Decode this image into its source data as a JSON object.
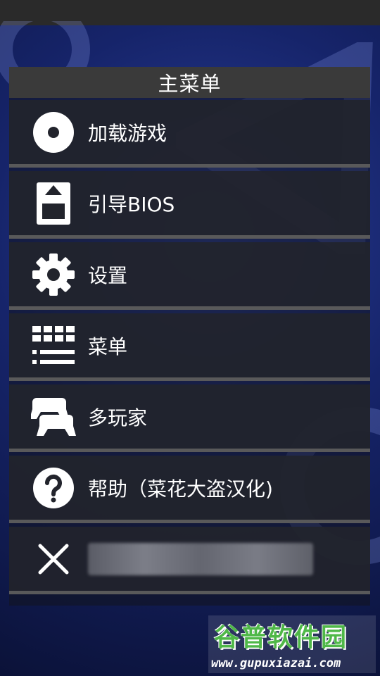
{
  "menu": {
    "title": "主菜单",
    "items": [
      {
        "label": "加载游戏",
        "icon": "disc-icon"
      },
      {
        "label": "引导BIOS",
        "icon": "memory-card-icon"
      },
      {
        "label": "设置",
        "icon": "gear-icon"
      },
      {
        "label": "菜单",
        "icon": "grid-menu-icon"
      },
      {
        "label": "多玩家",
        "icon": "gamepads-icon"
      },
      {
        "label": "帮助（菜花大盗汉化)",
        "icon": "help-icon"
      },
      {
        "label": "",
        "icon": "close-icon"
      }
    ]
  },
  "watermark": {
    "title": "谷普软件园",
    "url": "www.gupuxiazai.com"
  },
  "colors": {
    "title_bar": "#3a3a3a",
    "item_bg": "#22242c",
    "separator": "#5f5f5f",
    "watermark_green": "#4fb848"
  }
}
